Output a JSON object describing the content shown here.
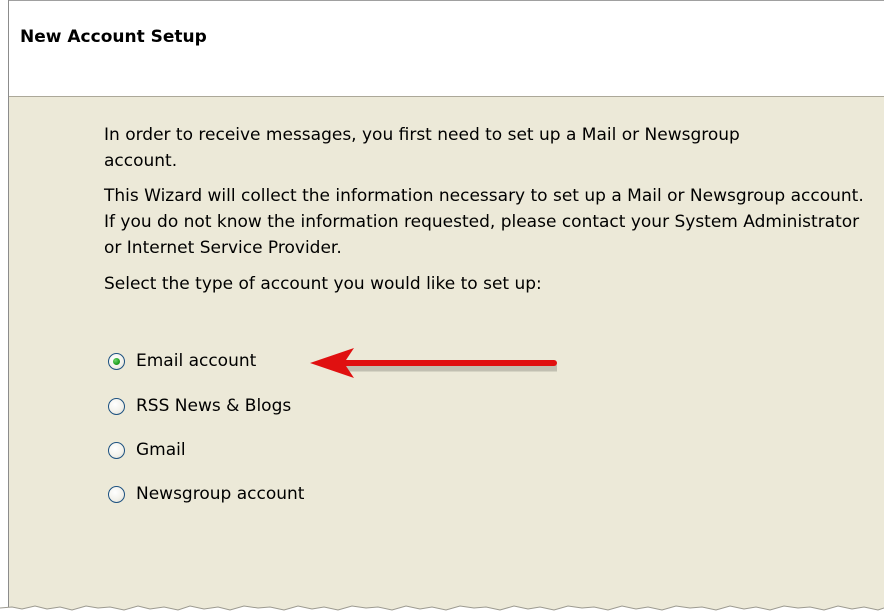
{
  "wizard": {
    "title": "New Account Setup",
    "intro": "In order to receive messages, you first need to set up a Mail or Newsgroup account.",
    "description": "This Wizard will collect the information necessary to set up a Mail or Newsgroup account. If you do not know the information requested, please contact your System Administrator or Internet Service Provider.",
    "prompt": "Select the type of account you would like to set up:",
    "options": [
      {
        "label": "Email account",
        "selected": true
      },
      {
        "label": "RSS News & Blogs",
        "selected": false
      },
      {
        "label": "Gmail",
        "selected": false
      },
      {
        "label": "Newsgroup account",
        "selected": false
      }
    ]
  },
  "colors": {
    "dialog_background": "#ece9d8",
    "header_background": "#ffffff",
    "radio_selected": "#21a121",
    "annotation_arrow": "#e01010"
  }
}
